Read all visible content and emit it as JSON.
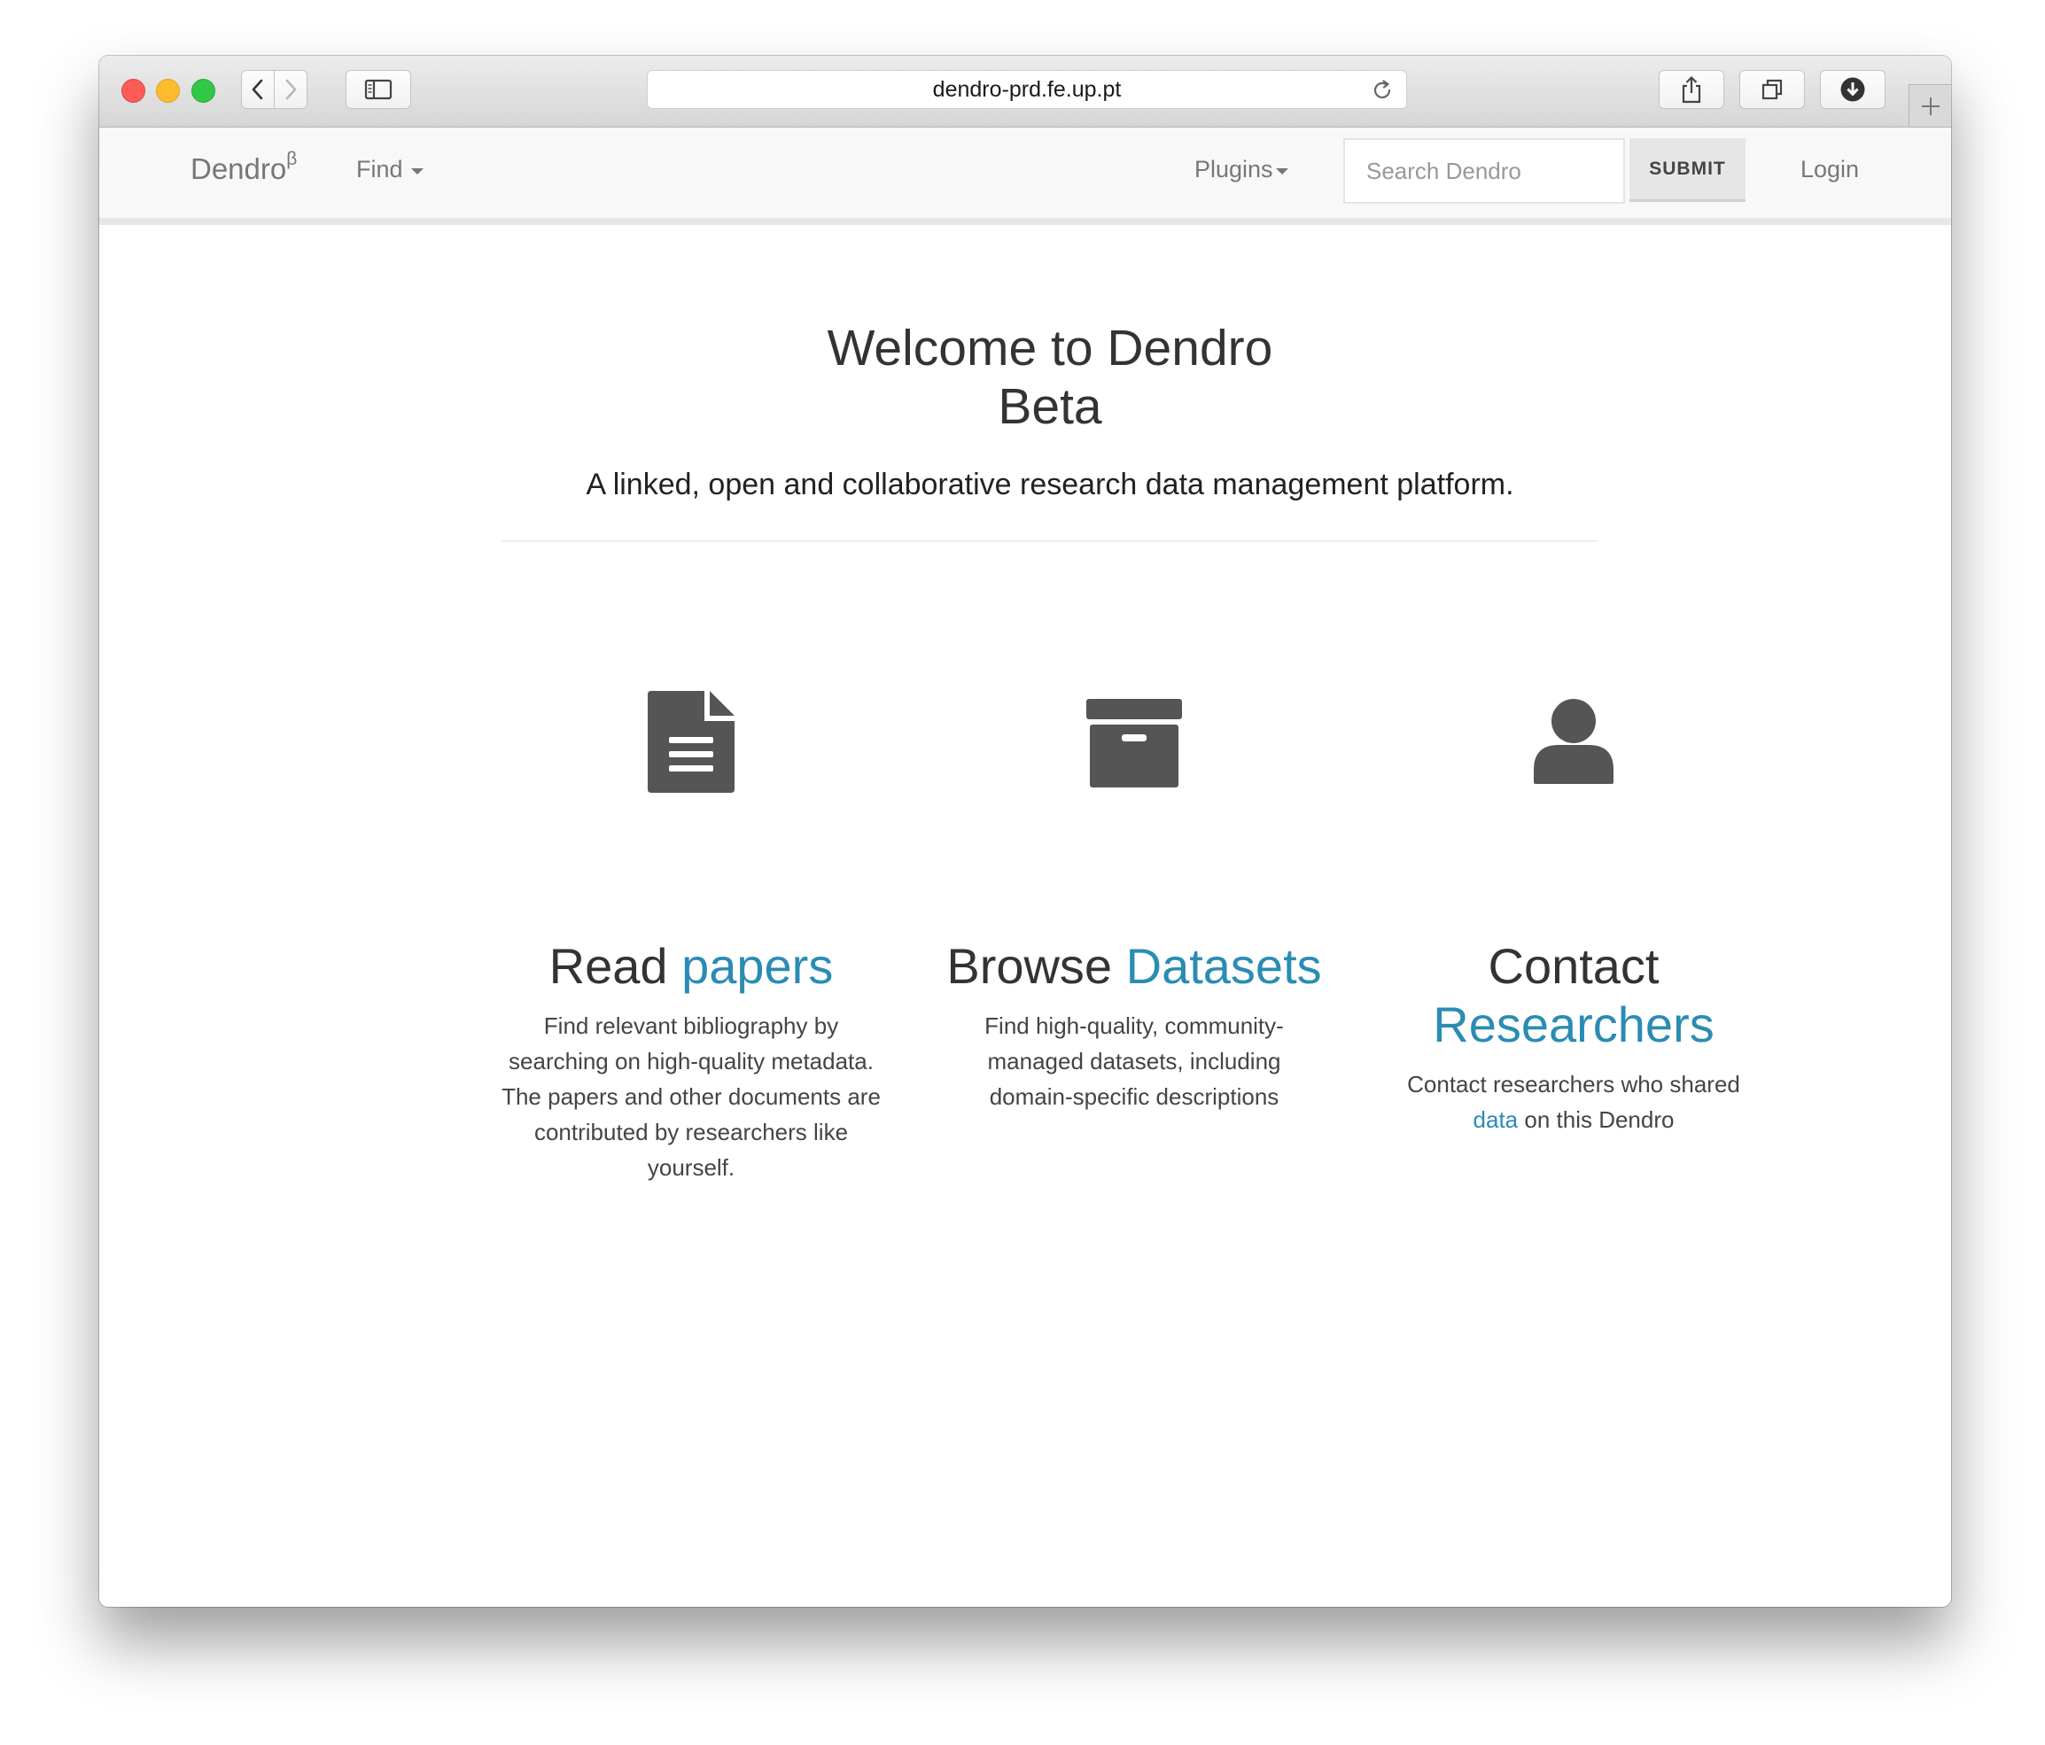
{
  "browser": {
    "url": "dendro-prd.fe.up.pt"
  },
  "navbar": {
    "brand": "Dendro",
    "brand_sup": "β",
    "find_label": "Find",
    "plugins_label": "Plugins",
    "search_placeholder": "Search Dendro",
    "submit_label": "SUBMIT",
    "login_label": "Login"
  },
  "hero": {
    "title_line1": "Welcome to Dendro",
    "title_line2": "Beta",
    "subtitle": "A linked, open and collaborative research data management platform."
  },
  "features": [
    {
      "icon": "document-icon",
      "title_plain": "Read ",
      "title_accent": "papers",
      "description": "Find relevant bibliography by searching on high-quality metadata. The papers and other documents are contributed by researchers like yourself."
    },
    {
      "icon": "archive-box-icon",
      "title_plain": "Browse ",
      "title_accent": "Datasets",
      "description": "Find high-quality, community-managed datasets, including domain-specific descriptions"
    },
    {
      "icon": "user-icon",
      "title_plain": "Contact",
      "title_accent": "Researchers",
      "description_before": "Contact researchers who shared",
      "description_link": "data",
      "description_after": " on this Dendro"
    }
  ],
  "colors": {
    "accent": "#2a8cb3",
    "icon": "#555555",
    "heading": "#333333",
    "navbar_bg": "#f8f8f8"
  }
}
